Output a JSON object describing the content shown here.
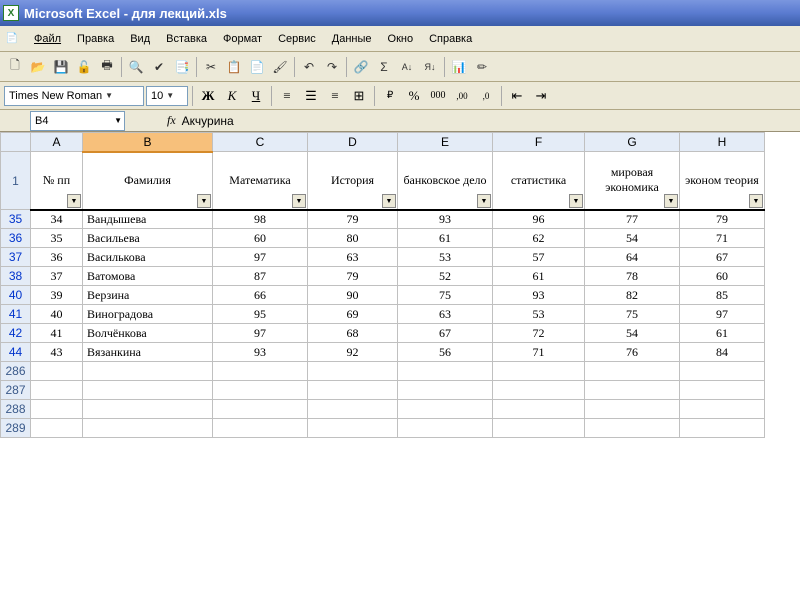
{
  "titlebar": {
    "app": "Microsoft Excel",
    "filename": "для лекций.xls"
  },
  "menu": {
    "items": [
      "Файл",
      "Правка",
      "Вид",
      "Вставка",
      "Формат",
      "Сервис",
      "Данные",
      "Окно",
      "Справка"
    ]
  },
  "fontbar": {
    "font_name": "Times New Roman",
    "font_size": "10",
    "bold": "Ж",
    "italic": "К",
    "underline": "Ч"
  },
  "namebox": {
    "ref": "B4"
  },
  "formula": {
    "fx": "fx",
    "value": "Акчурина"
  },
  "columns": [
    "A",
    "B",
    "C",
    "D",
    "E",
    "F",
    "G",
    "H"
  ],
  "headers": [
    "№ пп",
    "Фамилия",
    "Математика",
    "История",
    "банковское дело",
    "статистика",
    "мировая экономика",
    "эконом теория"
  ],
  "row_labels": [
    "35",
    "36",
    "37",
    "38",
    "40",
    "41",
    "42",
    "44",
    "286",
    "287",
    "288",
    "289"
  ],
  "rows": [
    {
      "n": "34",
      "fam": "Вандышева",
      "c": [
        "98",
        "79",
        "93",
        "96",
        "77",
        "79"
      ]
    },
    {
      "n": "35",
      "fam": "Васильева",
      "c": [
        "60",
        "80",
        "61",
        "62",
        "54",
        "71"
      ]
    },
    {
      "n": "36",
      "fam": "Василькова",
      "c": [
        "97",
        "63",
        "53",
        "57",
        "64",
        "67"
      ]
    },
    {
      "n": "37",
      "fam": "Ватомова",
      "c": [
        "87",
        "79",
        "52",
        "61",
        "78",
        "60"
      ]
    },
    {
      "n": "39",
      "fam": "Верзина",
      "c": [
        "66",
        "90",
        "75",
        "93",
        "82",
        "85"
      ]
    },
    {
      "n": "40",
      "fam": "Виноградова",
      "c": [
        "95",
        "69",
        "63",
        "53",
        "75",
        "97"
      ]
    },
    {
      "n": "41",
      "fam": "Волчёнкова",
      "c": [
        "97",
        "68",
        "67",
        "72",
        "54",
        "61"
      ]
    },
    {
      "n": "43",
      "fam": "Вязанкина",
      "c": [
        "93",
        "92",
        "56",
        "71",
        "76",
        "84"
      ]
    }
  ],
  "chart_data": {
    "type": "table",
    "title": "",
    "columns": [
      "№ пп",
      "Фамилия",
      "Математика",
      "История",
      "банковское дело",
      "статистика",
      "мировая экономика",
      "эконом теория"
    ],
    "data": [
      [
        34,
        "Вандышева",
        98,
        79,
        93,
        96,
        77,
        79
      ],
      [
        35,
        "Васильева",
        60,
        80,
        61,
        62,
        54,
        71
      ],
      [
        36,
        "Василькова",
        97,
        63,
        53,
        57,
        64,
        67
      ],
      [
        37,
        "Ватомова",
        87,
        79,
        52,
        61,
        78,
        60
      ],
      [
        39,
        "Верзина",
        66,
        90,
        75,
        93,
        82,
        85
      ],
      [
        40,
        "Виноградова",
        95,
        69,
        63,
        53,
        75,
        97
      ],
      [
        41,
        "Волчёнкова",
        97,
        68,
        67,
        72,
        54,
        61
      ],
      [
        43,
        "Вязанкина",
        93,
        92,
        56,
        71,
        76,
        84
      ]
    ]
  }
}
